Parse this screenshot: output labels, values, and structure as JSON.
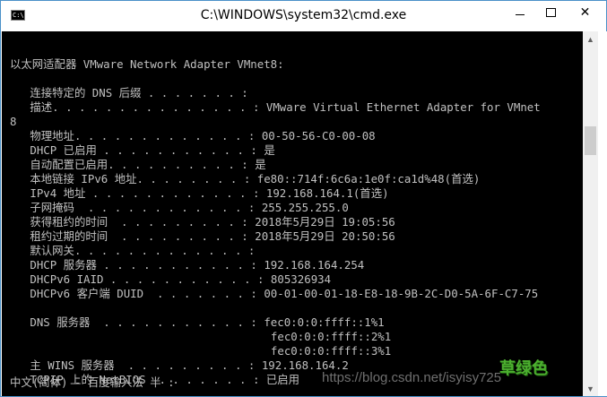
{
  "window": {
    "title": "C:\\WINDOWS\\system32\\cmd.exe",
    "icon": "console-app-icon",
    "icon_text": "C:\\."
  },
  "console_lines": [
    "",
    "以太网适配器 VMware Network Adapter VMnet8:",
    "",
    "   连接特定的 DNS 后缀 . . . . . . . :",
    "   描述. . . . . . . . . . . . . . . : VMware Virtual Ethernet Adapter for VMnet",
    "8",
    "   物理地址. . . . . . . . . . . . . : 00-50-56-C0-00-08",
    "   DHCP 已启用 . . . . . . . . . . . : 是",
    "   自动配置已启用. . . . . . . . . . : 是",
    "   本地链接 IPv6 地址. . . . . . . . : fe80::714f:6c6a:1e0f:ca1d%48(首选)",
    "   IPv4 地址 . . . . . . . . . . . . : 192.168.164.1(首选)",
    "   子网掩码  . . . . . . . . . . . . : 255.255.255.0",
    "   获得租约的时间  . . . . . . . . . : 2018年5月29日 19:05:56",
    "   租约过期的时间  . . . . . . . . . : 2018年5月29日 20:50:56",
    "   默认网关. . . . . . . . . . . . . :",
    "   DHCP 服务器 . . . . . . . . . . . : 192.168.164.254",
    "   DHCPv6 IAID . . . . . . . . . . . : 805326934",
    "   DHCPv6 客户端 DUID  . . . . . . . : 00-01-00-01-18-E8-18-9B-2C-D0-5A-6F-C7-75",
    "",
    "   DNS 服务器  . . . . . . . . . . . : fec0:0:0:ffff::1%1",
    "                                       fec0:0:0:ffff::2%1",
    "                                       fec0:0:0:ffff::3%1",
    "   主 WINS 服务器  . . . . . . . . . : 192.168.164.2",
    "   TCPIP 上的 NetBIOS  . . . . . . . : 已启用"
  ],
  "ime_status": "中文(简体) - 百度输入法 半 :",
  "watermark": "https://blog.csdn.net/isyisy725",
  "logo_text": "草绿色",
  "colors": {
    "console_bg": "#000000",
    "console_fg": "#c0c0c0",
    "logo": "#4caf2f"
  }
}
